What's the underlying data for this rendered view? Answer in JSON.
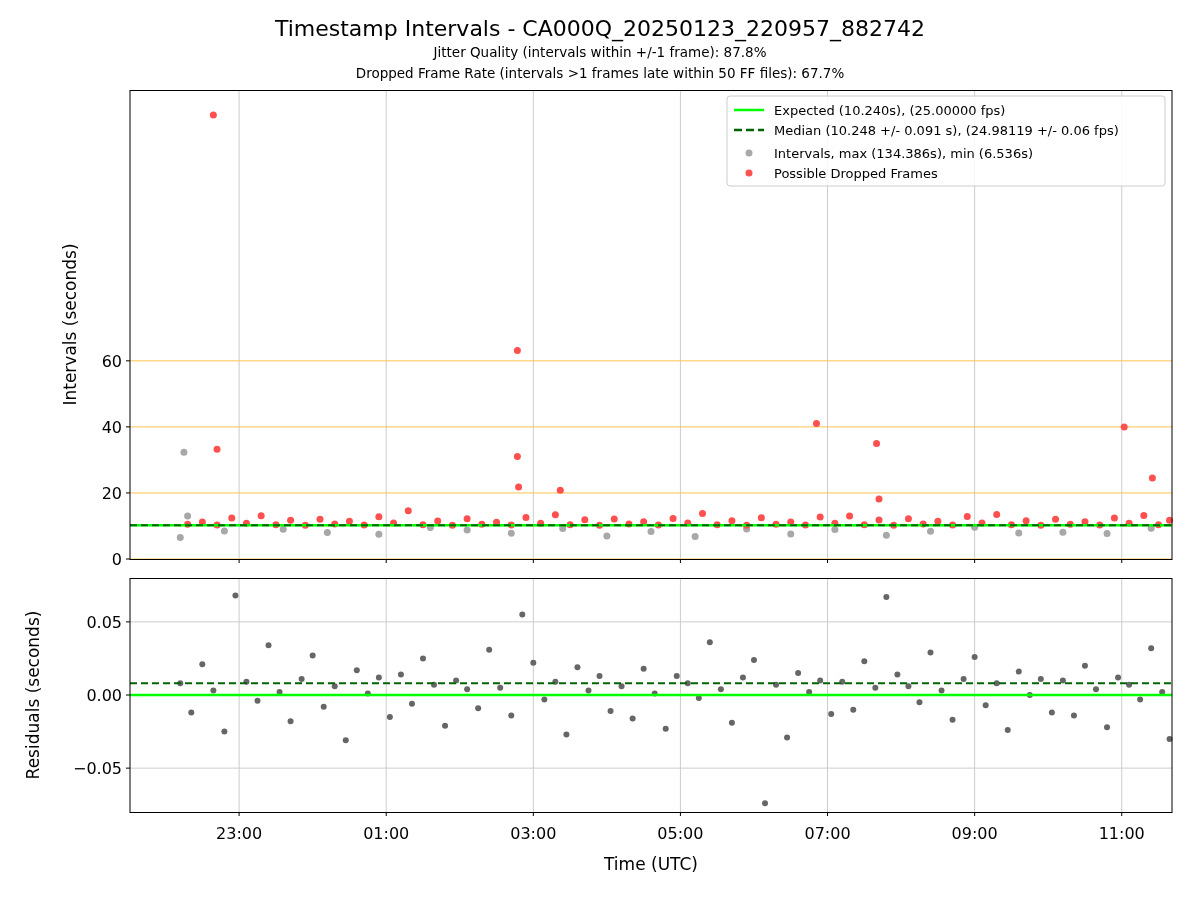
{
  "title": "Timestamp Intervals - CA000Q_20250123_220957_882742",
  "subtitles": [
    "Jitter Quality (intervals within +/-1 frame): 87.8%",
    "Dropped Frame Rate (intervals >1 frames late within 50 FF files): 67.7%"
  ],
  "charts": [
    {
      "chart_data": {
        "type": "scatter",
        "ylabel": "Intervals (seconds)",
        "xlim": [
          "2025-01-23T21:31",
          "2025-01-24T11:41"
        ],
        "ylim": [
          0,
          142
        ],
        "yticks": [
          {
            "value": 0,
            "label": "0"
          },
          {
            "value": 20,
            "label": "20"
          },
          {
            "value": 40,
            "label": "40"
          },
          {
            "value": 60,
            "label": "60"
          }
        ],
        "series": [
          {
            "name": "Intervals, max (134.386s), min (6.536s)",
            "color": "#a8a8a8",
            "x": [
              "2025-01-23T22:12",
              "2025-01-23T22:15",
              "2025-01-23T22:18",
              "2025-01-23T22:48",
              "2025-01-23T23:36",
              "2025-01-24T00:12",
              "2025-01-24T00:54",
              "2025-01-24T01:36",
              "2025-01-24T02:06",
              "2025-01-24T02:42",
              "2025-01-24T03:24",
              "2025-01-24T04:00",
              "2025-01-24T04:36",
              "2025-01-24T05:12",
              "2025-01-24T05:54",
              "2025-01-24T06:30",
              "2025-01-24T07:06",
              "2025-01-24T07:48",
              "2025-01-24T08:24",
              "2025-01-24T09:00",
              "2025-01-24T09:36",
              "2025-01-24T10:12",
              "2025-01-24T10:48",
              "2025-01-24T11:24"
            ],
            "values": [
              6.5,
              32.3,
              13.0,
              8.5,
              9.0,
              8.0,
              7.5,
              9.5,
              8.8,
              7.8,
              9.2,
              7.0,
              8.3,
              6.8,
              9.1,
              7.6,
              8.9,
              7.2,
              8.4,
              9.6,
              7.9,
              8.1,
              7.7,
              9.3
            ]
          },
          {
            "name": "Possible Dropped Frames",
            "color": "#ff5050",
            "x": [
              "2025-01-23T22:18",
              "2025-01-23T22:30",
              "2025-01-23T22:42",
              "2025-01-23T22:54",
              "2025-01-23T23:06",
              "2025-01-23T23:18",
              "2025-01-23T23:30",
              "2025-01-23T23:42",
              "2025-01-23T23:54",
              "2025-01-24T00:06",
              "2025-01-24T00:18",
              "2025-01-24T00:30",
              "2025-01-24T00:42",
              "2025-01-24T00:54",
              "2025-01-24T01:06",
              "2025-01-24T01:18",
              "2025-01-24T01:30",
              "2025-01-24T01:42",
              "2025-01-24T01:54",
              "2025-01-24T02:06",
              "2025-01-24T02:18",
              "2025-01-24T02:30",
              "2025-01-24T02:42",
              "2025-01-24T02:54",
              "2025-01-24T03:06",
              "2025-01-24T03:18",
              "2025-01-24T03:30",
              "2025-01-24T03:42",
              "2025-01-24T03:54",
              "2025-01-24T04:06",
              "2025-01-24T04:18",
              "2025-01-24T04:30",
              "2025-01-24T04:42",
              "2025-01-24T04:54",
              "2025-01-24T05:06",
              "2025-01-24T05:18",
              "2025-01-24T05:30",
              "2025-01-24T05:42",
              "2025-01-24T05:54",
              "2025-01-24T06:06",
              "2025-01-24T06:18",
              "2025-01-24T06:30",
              "2025-01-24T06:42",
              "2025-01-24T06:54",
              "2025-01-24T07:06",
              "2025-01-24T07:18",
              "2025-01-24T07:30",
              "2025-01-24T07:42",
              "2025-01-24T07:54",
              "2025-01-24T08:06",
              "2025-01-24T08:18",
              "2025-01-24T08:30",
              "2025-01-24T08:42",
              "2025-01-24T08:54",
              "2025-01-24T09:06",
              "2025-01-24T09:18",
              "2025-01-24T09:30",
              "2025-01-24T09:42",
              "2025-01-24T09:54",
              "2025-01-24T10:06",
              "2025-01-24T10:18",
              "2025-01-24T10:30",
              "2025-01-24T10:42",
              "2025-01-24T10:54",
              "2025-01-24T11:06",
              "2025-01-24T11:18",
              "2025-01-24T11:30",
              "2025-01-24T11:39",
              "2025-01-23T22:39",
              "2025-01-23T22:42",
              "2025-01-24T02:47",
              "2025-01-24T02:47",
              "2025-01-24T02:48",
              "2025-01-24T03:22",
              "2025-01-24T06:51",
              "2025-01-24T07:40",
              "2025-01-24T07:42",
              "2025-01-24T11:02",
              "2025-01-24T11:25"
            ],
            "values": [
              10.5,
              11.2,
              10.3,
              12.4,
              10.8,
              13.1,
              10.4,
              11.7,
              10.2,
              12.0,
              10.6,
              11.4,
              10.3,
              12.8,
              10.9,
              14.6,
              10.4,
              11.5,
              10.2,
              12.2,
              10.5,
              11.1,
              10.3,
              12.6,
              10.8,
              13.4,
              10.4,
              11.9,
              10.2,
              12.1,
              10.6,
              11.3,
              10.3,
              12.3,
              10.9,
              13.8,
              10.4,
              11.6,
              10.2,
              12.5,
              10.5,
              11.2,
              10.3,
              12.7,
              10.8,
              13.0,
              10.4,
              11.8,
              10.2,
              12.2,
              10.6,
              11.4,
              10.3,
              12.9,
              10.9,
              13.5,
              10.4,
              11.6,
              10.2,
              12.0,
              10.5,
              11.3,
              10.3,
              12.4,
              10.8,
              13.2,
              10.4,
              11.7,
              134.4,
              33.2,
              63.1,
              31.0,
              21.8,
              20.8,
              41.0,
              35.0,
              18.2,
              40.0,
              24.5
            ]
          }
        ],
        "ref_lines": [
          {
            "axis": "y",
            "label": "Expected (10.240s), (25.00000 fps)",
            "value": 10.24,
            "color": "#00ff00"
          },
          {
            "axis": "y",
            "label": "Median (10.248 +/- 0.091 s), (24.98119 +/- 0.06 fps)",
            "value": 10.248,
            "color": "#006400"
          }
        ],
        "grid": true,
        "legend": true
      }
    },
    {
      "chart_data": {
        "type": "scatter",
        "xlabel": "Time (UTC)",
        "ylabel": "Residuals (seconds)",
        "xlim": [
          "2025-01-23T21:31",
          "2025-01-24T11:41"
        ],
        "ylim": [
          -0.08,
          0.08
        ],
        "xticks": [
          {
            "value": "2025-01-23T23:00",
            "label": "23:00"
          },
          {
            "value": "2025-01-24T01:00",
            "label": "01:00"
          },
          {
            "value": "2025-01-24T03:00",
            "label": "03:00"
          },
          {
            "value": "2025-01-24T05:00",
            "label": "05:00"
          },
          {
            "value": "2025-01-24T07:00",
            "label": "07:00"
          },
          {
            "value": "2025-01-24T09:00",
            "label": "09:00"
          },
          {
            "value": "2025-01-24T11:00",
            "label": "11:00"
          }
        ],
        "yticks": [
          {
            "value": -0.05,
            "label": "−0.05"
          },
          {
            "value": 0,
            "label": "0.00"
          },
          {
            "value": 0.05,
            "label": "0.05"
          }
        ],
        "series": [
          {
            "color": "#666666",
            "x": [
              "2025-01-23T22:12",
              "2025-01-23T22:21",
              "2025-01-23T22:30",
              "2025-01-23T22:39",
              "2025-01-23T22:48",
              "2025-01-23T22:57",
              "2025-01-23T23:06",
              "2025-01-23T23:15",
              "2025-01-23T23:24",
              "2025-01-23T23:33",
              "2025-01-23T23:42",
              "2025-01-23T23:51",
              "2025-01-24T00:00",
              "2025-01-24T00:09",
              "2025-01-24T00:18",
              "2025-01-24T00:27",
              "2025-01-24T00:36",
              "2025-01-24T00:45",
              "2025-01-24T00:54",
              "2025-01-24T01:03",
              "2025-01-24T01:12",
              "2025-01-24T01:21",
              "2025-01-24T01:30",
              "2025-01-24T01:39",
              "2025-01-24T01:48",
              "2025-01-24T01:57",
              "2025-01-24T02:06",
              "2025-01-24T02:15",
              "2025-01-24T02:24",
              "2025-01-24T02:33",
              "2025-01-24T02:42",
              "2025-01-24T02:51",
              "2025-01-24T03:00",
              "2025-01-24T03:09",
              "2025-01-24T03:18",
              "2025-01-24T03:27",
              "2025-01-24T03:36",
              "2025-01-24T03:45",
              "2025-01-24T03:54",
              "2025-01-24T04:03",
              "2025-01-24T04:12",
              "2025-01-24T04:21",
              "2025-01-24T04:30",
              "2025-01-24T04:39",
              "2025-01-24T04:48",
              "2025-01-24T04:57",
              "2025-01-24T05:06",
              "2025-01-24T05:15",
              "2025-01-24T05:24",
              "2025-01-24T05:33",
              "2025-01-24T05:42",
              "2025-01-24T05:51",
              "2025-01-24T06:00",
              "2025-01-24T06:09",
              "2025-01-24T06:18",
              "2025-01-24T06:27",
              "2025-01-24T06:36",
              "2025-01-24T06:45",
              "2025-01-24T06:54",
              "2025-01-24T07:03",
              "2025-01-24T07:12",
              "2025-01-24T07:21",
              "2025-01-24T07:30",
              "2025-01-24T07:39",
              "2025-01-24T07:48",
              "2025-01-24T07:57",
              "2025-01-24T08:06",
              "2025-01-24T08:15",
              "2025-01-24T08:24",
              "2025-01-24T08:33",
              "2025-01-24T08:42",
              "2025-01-24T08:51",
              "2025-01-24T09:00",
              "2025-01-24T09:09",
              "2025-01-24T09:18",
              "2025-01-24T09:27",
              "2025-01-24T09:36",
              "2025-01-24T09:45",
              "2025-01-24T09:54",
              "2025-01-24T10:03",
              "2025-01-24T10:12",
              "2025-01-24T10:21",
              "2025-01-24T10:30",
              "2025-01-24T10:39",
              "2025-01-24T10:48",
              "2025-01-24T10:57",
              "2025-01-24T11:06",
              "2025-01-24T11:15",
              "2025-01-24T11:24",
              "2025-01-24T11:33",
              "2025-01-24T11:39"
            ],
            "values": [
              0.008,
              -0.012,
              0.021,
              0.003,
              -0.025,
              0.068,
              0.009,
              -0.004,
              0.034,
              0.002,
              -0.018,
              0.011,
              0.027,
              -0.008,
              0.006,
              -0.031,
              0.017,
              0.001,
              0.012,
              -0.015,
              0.014,
              -0.006,
              0.025,
              0.007,
              -0.021,
              0.01,
              0.004,
              -0.009,
              0.031,
              0.005,
              -0.014,
              0.055,
              0.022,
              -0.003,
              0.009,
              -0.027,
              0.019,
              0.003,
              0.013,
              -0.011,
              0.006,
              -0.016,
              0.018,
              0.001,
              -0.023,
              0.013,
              0.008,
              -0.002,
              0.036,
              0.004,
              -0.019,
              0.012,
              0.024,
              -0.074,
              0.007,
              -0.029,
              0.015,
              0.002,
              0.01,
              -0.013,
              0.009,
              -0.01,
              0.023,
              0.005,
              0.067,
              0.014,
              0.006,
              -0.005,
              0.029,
              0.003,
              -0.017,
              0.011,
              0.026,
              -0.007,
              0.008,
              -0.024,
              0.016,
              0.0,
              0.011,
              -0.012,
              0.01,
              -0.014,
              0.02,
              0.004,
              -0.022,
              0.012,
              0.007,
              -0.003,
              0.032,
              0.002,
              -0.03
            ]
          }
        ],
        "ref_lines": [
          {
            "axis": "y",
            "value": 0,
            "color": "#00ff00"
          },
          {
            "axis": "y",
            "value": 0.008,
            "color": "#006400"
          }
        ],
        "grid": true
      }
    }
  ]
}
